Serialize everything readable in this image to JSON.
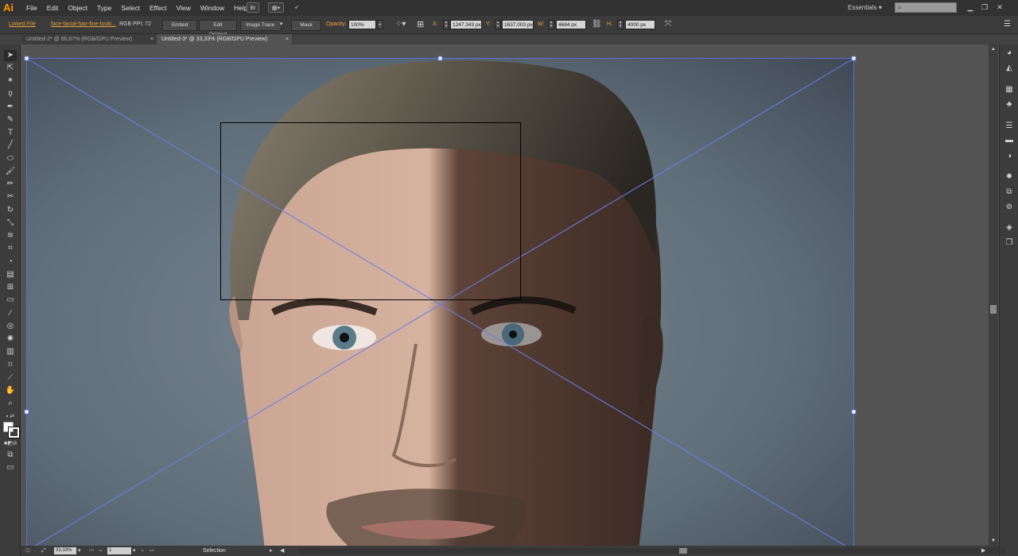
{
  "app": {
    "logo": "Ai",
    "menus": [
      "File",
      "Edit",
      "Object",
      "Type",
      "Select",
      "Effect",
      "View",
      "Window",
      "Help"
    ],
    "bridge_button": "Br",
    "workspace": "Essentials",
    "search_icon": "search-icon"
  },
  "controlbar": {
    "linked_file_label": "Linked File",
    "file_name": "face-facial-hair-fine-looki...",
    "color_mode": "RGB",
    "ppi": "PPI: 72",
    "embed": "Embed",
    "edit_original": "Edit Original",
    "image_trace": "Image Trace",
    "mask": "Mask",
    "opacity_label": "Opacity:",
    "opacity_value": "100%",
    "x_label": "X:",
    "x_value": "1247,343 px",
    "y_label": "Y:",
    "y_value": "1637,003 px",
    "w_label": "W:",
    "w_value": "4684 px",
    "h_label": "H:",
    "h_value": "4000 px"
  },
  "tabs": [
    {
      "label": "Untitled-2* @ 66,67% (RGB/GPU Preview)",
      "active": false
    },
    {
      "label": "Untitled-3* @ 33,33% (RGB/GPU Preview)",
      "active": true
    }
  ],
  "statusbar": {
    "zoom": "33,33%",
    "artboard": "1",
    "tool": "Selection"
  },
  "colors": {
    "accent_orange": "#e8a33a",
    "selection_blue": "#5a6fd6"
  }
}
